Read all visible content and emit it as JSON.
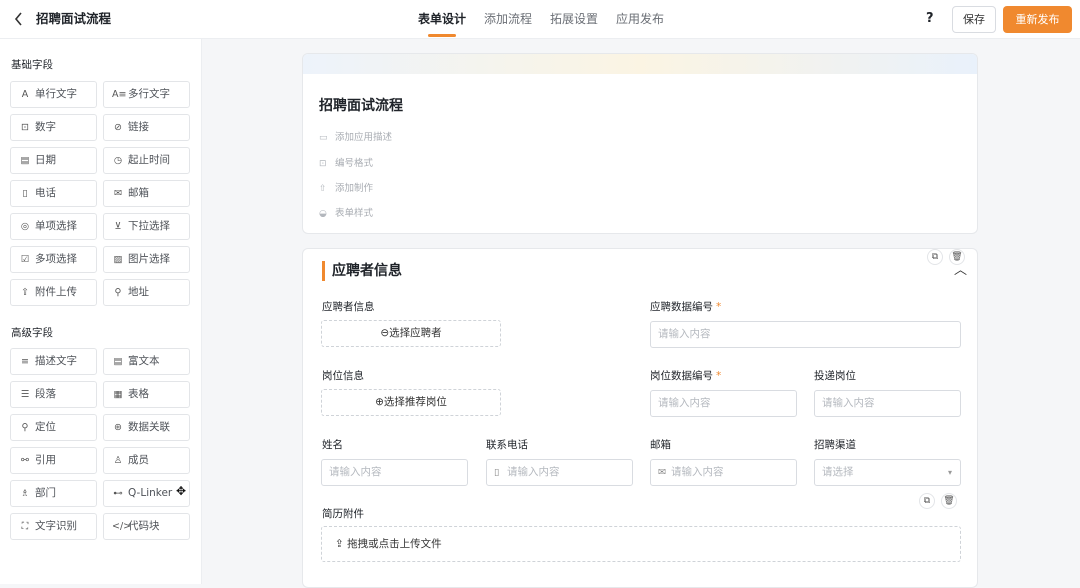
{
  "header": {
    "back_icon": "chevron-left-icon",
    "title": "招聘面试流程",
    "tabs": [
      {
        "label": "表单设计",
        "active": true
      },
      {
        "label": "添加流程",
        "active": false
      },
      {
        "label": "拓展设置",
        "active": false
      },
      {
        "label": "应用发布",
        "active": false
      }
    ],
    "help_label": "?",
    "save_label": "保存",
    "publish_label": "重新发布",
    "accent_color": "#f0892f"
  },
  "sidebar": {
    "basic_title": "基础字段",
    "basic_fields": [
      {
        "label": "单行文字",
        "icon": "A"
      },
      {
        "label": "多行文字",
        "icon": "A≡"
      },
      {
        "label": "数字",
        "icon": "⊡"
      },
      {
        "label": "链接",
        "icon": "⊘"
      },
      {
        "label": "日期",
        "icon": "▤"
      },
      {
        "label": "起止时间",
        "icon": "◷"
      },
      {
        "label": "电话",
        "icon": "▯"
      },
      {
        "label": "邮箱",
        "icon": "✉"
      },
      {
        "label": "单项选择",
        "icon": "◎"
      },
      {
        "label": "下拉选择",
        "icon": "⊻"
      },
      {
        "label": "多项选择",
        "icon": "☑"
      },
      {
        "label": "图片选择",
        "icon": "▨"
      },
      {
        "label": "附件上传",
        "icon": "⇪"
      },
      {
        "label": "地址",
        "icon": "⚲"
      }
    ],
    "advanced_title": "高级字段",
    "advanced_fields": [
      {
        "label": "描述文字",
        "icon": "≡"
      },
      {
        "label": "富文本",
        "icon": "▤"
      },
      {
        "label": "段落",
        "icon": "☰"
      },
      {
        "label": "表格",
        "icon": "▦"
      },
      {
        "label": "定位",
        "icon": "⚲"
      },
      {
        "label": "数据关联",
        "icon": "⊛"
      },
      {
        "label": "引用",
        "icon": "⚯"
      },
      {
        "label": "成员",
        "icon": "♙"
      },
      {
        "label": "部门",
        "icon": "♗"
      },
      {
        "label": "Q-Linker",
        "icon": "⊷"
      },
      {
        "label": "文字识别",
        "icon": "⛶"
      },
      {
        "label": "代码块",
        "icon": "</>"
      }
    ]
  },
  "form": {
    "title": "招聘面试流程",
    "meta": [
      {
        "label": "添加应用描述",
        "icon": "comment-icon"
      },
      {
        "label": "编号格式",
        "icon": "number-icon"
      },
      {
        "label": "添加制作",
        "icon": "upload-icon"
      },
      {
        "label": "表单样式",
        "icon": "palette-icon"
      }
    ],
    "section_title": "应聘者信息",
    "fields": {
      "applicant_label": "应聘者信息",
      "applicant_button": "⊖选择应聘者",
      "applicant_no_label": "应聘数据编号",
      "applicant_no_placeholder": "请输入内容",
      "position_label": "岗位信息",
      "position_button": "⊕选择推荐岗位",
      "position_no_label": "岗位数据编号",
      "position_no_placeholder": "请输入内容",
      "apply_position_label": "投递岗位",
      "apply_position_placeholder": "请输入内容",
      "name_label": "姓名",
      "name_placeholder": "请输入内容",
      "phone_label": "联系电话",
      "phone_placeholder": "请输入内容",
      "email_label": "邮箱",
      "email_placeholder": "请输入内容",
      "channel_label": "招聘渠道",
      "channel_placeholder": "请选择",
      "resume_label": "简历附件",
      "resume_upload": "拖拽或点击上传文件"
    }
  }
}
